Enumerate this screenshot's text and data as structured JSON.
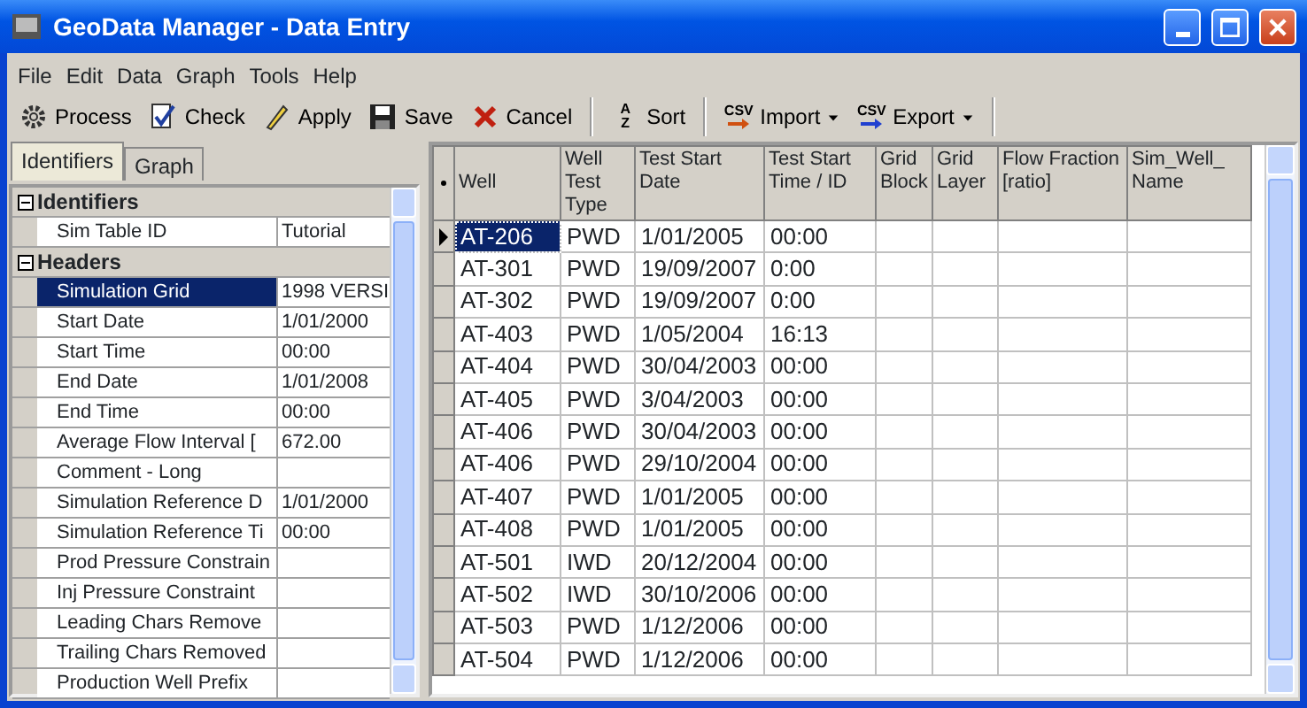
{
  "window": {
    "title": "GeoData Manager - Data Entry"
  },
  "menu": [
    "File",
    "Edit",
    "Data",
    "Graph",
    "Tools",
    "Help"
  ],
  "toolbar": [
    {
      "kind": "gear",
      "label": "Process"
    },
    {
      "kind": "check",
      "label": "Check"
    },
    {
      "kind": "bolt",
      "label": "Apply"
    },
    {
      "kind": "floppy",
      "label": "Save"
    },
    {
      "kind": "cross",
      "label": "Cancel"
    },
    {
      "kind": "sort",
      "label": "Sort",
      "icon_text": [
        "A",
        "Z"
      ]
    },
    {
      "kind": "import",
      "label": "Import",
      "icon_text": [
        "CSV"
      ],
      "dropdown": true
    },
    {
      "kind": "export",
      "label": "Export",
      "icon_text": [
        "CSV"
      ],
      "dropdown": true
    }
  ],
  "tabs": [
    {
      "label": "Identifiers",
      "selected": true
    },
    {
      "label": "Graph",
      "selected": false
    }
  ],
  "properties": [
    {
      "group": "Identifiers",
      "expanded": true,
      "items": [
        {
          "label": "Sim Table ID",
          "value": "Tutorial",
          "selected": false
        }
      ]
    },
    {
      "group": "Headers",
      "expanded": true,
      "items": [
        {
          "label": "Simulation Grid",
          "value": "1998 VERSI",
          "selected": true
        },
        {
          "label": "Start Date",
          "value": "1/01/2000",
          "selected": false
        },
        {
          "label": "Start Time",
          "value": "00:00",
          "selected": false
        },
        {
          "label": "End Date",
          "value": "1/01/2008",
          "selected": false
        },
        {
          "label": "End Time",
          "value": "00:00",
          "selected": false
        },
        {
          "label": "Average Flow Interval [",
          "value": "672.00",
          "selected": false
        },
        {
          "label": "Comment - Long",
          "value": "",
          "selected": false
        },
        {
          "label": "Simulation Reference D",
          "value": "1/01/2000",
          "selected": false
        },
        {
          "label": "Simulation Reference Ti",
          "value": "00:00",
          "selected": false
        },
        {
          "label": "Prod Pressure Constrain",
          "value": "",
          "selected": false
        },
        {
          "label": "Inj Pressure Constraint",
          "value": "",
          "selected": false
        },
        {
          "label": "Leading Chars Remove",
          "value": "",
          "selected": false
        },
        {
          "label": "Trailing Chars Removed",
          "value": "",
          "selected": false
        },
        {
          "label": "Production Well Prefix",
          "value": "",
          "selected": false
        }
      ]
    }
  ],
  "table": {
    "columns": [
      "Well",
      "Well Test Type",
      "Test Start Date",
      "Test Start Time / ID",
      "Grid Block",
      "Grid Layer",
      "Flow Fraction [ratio]",
      "Sim_Well_ Name"
    ],
    "rows": [
      {
        "cells": [
          "AT-206",
          "PWD",
          "1/01/2005",
          "00:00"
        ],
        "selected": true
      },
      {
        "cells": [
          "AT-301",
          "PWD",
          "19/09/2007",
          "0:00"
        ],
        "selected": false
      },
      {
        "cells": [
          "AT-302",
          "PWD",
          "19/09/2007",
          "0:00"
        ],
        "selected": false
      },
      {
        "cells": [
          "AT-403",
          "PWD",
          "1/05/2004",
          "16:13"
        ],
        "selected": false
      },
      {
        "cells": [
          "AT-404",
          "PWD",
          "30/04/2003",
          "00:00"
        ],
        "selected": false
      },
      {
        "cells": [
          "AT-405",
          "PWD",
          "3/04/2003",
          "00:00"
        ],
        "selected": false
      },
      {
        "cells": [
          "AT-406",
          "PWD",
          "30/04/2003",
          "00:00"
        ],
        "selected": false
      },
      {
        "cells": [
          "AT-406",
          "PWD",
          "29/10/2004",
          "00:00"
        ],
        "selected": false
      },
      {
        "cells": [
          "AT-407",
          "PWD",
          "1/01/2005",
          "00:00"
        ],
        "selected": false
      },
      {
        "cells": [
          "AT-408",
          "PWD",
          "1/01/2005",
          "00:00"
        ],
        "selected": false
      },
      {
        "cells": [
          "AT-501",
          "IWD",
          "20/12/2004",
          "00:00"
        ],
        "selected": false
      },
      {
        "cells": [
          "AT-502",
          "IWD",
          "30/10/2006",
          "00:00"
        ],
        "selected": false
      },
      {
        "cells": [
          "AT-503",
          "PWD",
          "1/12/2006",
          "00:00"
        ],
        "selected": false
      },
      {
        "cells": [
          "AT-504",
          "PWD",
          "1/12/2006",
          "00:00"
        ],
        "selected": false
      }
    ]
  }
}
